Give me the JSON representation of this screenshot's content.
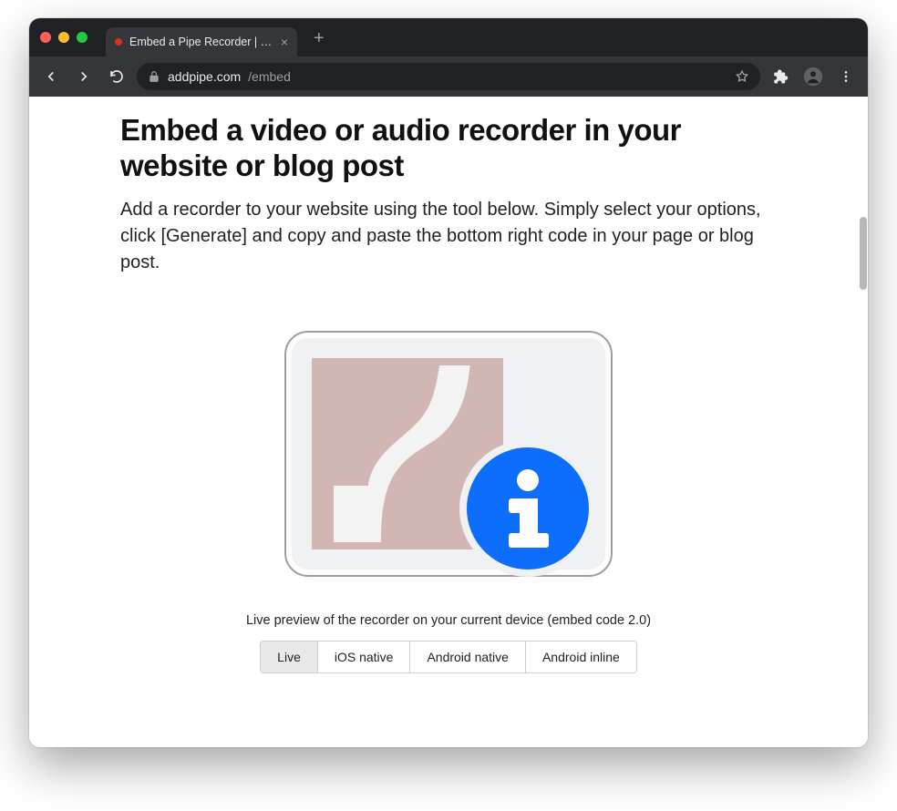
{
  "browser": {
    "tab_title": "Embed a Pipe Recorder | addpi",
    "url_host": "addpipe.com",
    "url_path": "/embed"
  },
  "page": {
    "heading": "Embed a video or audio recorder in your website or blog post",
    "subtext": "Add a recorder to your website using the tool below. Simply select your options, click [Generate] and copy and paste the bottom right code in your page or blog post.",
    "preview_caption": "Live preview of the recorder on your current device (embed code 2.0)",
    "mode_tabs": [
      "Live",
      "iOS native",
      "Android native",
      "Android inline"
    ],
    "active_tab_index": 0
  },
  "icons": {
    "plugin": "flash-info"
  }
}
